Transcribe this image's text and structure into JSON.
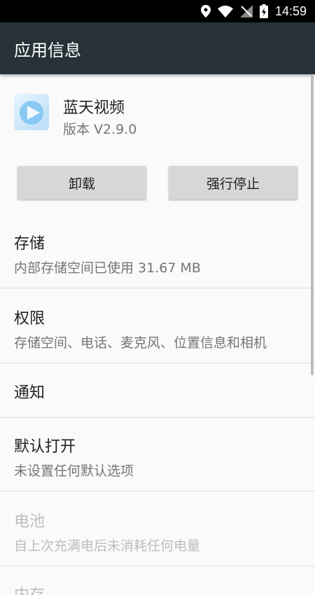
{
  "status_bar": {
    "time": "14:59"
  },
  "toolbar": {
    "title": "应用信息"
  },
  "app": {
    "name": "蓝天视频",
    "version": "版本 V2.9.0"
  },
  "buttons": {
    "uninstall": "卸载",
    "force_stop": "强行停止"
  },
  "items": [
    {
      "title": "存储",
      "subtitle": "内部存储空间已使用 31.67 MB",
      "enabled": true
    },
    {
      "title": "权限",
      "subtitle": "存储空间、电话、麦克风、位置信息和相机",
      "enabled": true
    },
    {
      "title": "通知",
      "subtitle": "",
      "enabled": true
    },
    {
      "title": "默认打开",
      "subtitle": "未设置任何默认选项",
      "enabled": true
    },
    {
      "title": "电池",
      "subtitle": "自上次充满电后未消耗任何电量",
      "enabled": false
    },
    {
      "title": "内存",
      "subtitle": "",
      "enabled": false
    }
  ],
  "colors": {
    "toolbar": "#263238",
    "status_bar": "#000000",
    "background": "#fafafa"
  },
  "icons": [
    "location-icon",
    "wifi-icon",
    "no-signal-icon",
    "battery-charging-icon",
    "app-icon"
  ]
}
